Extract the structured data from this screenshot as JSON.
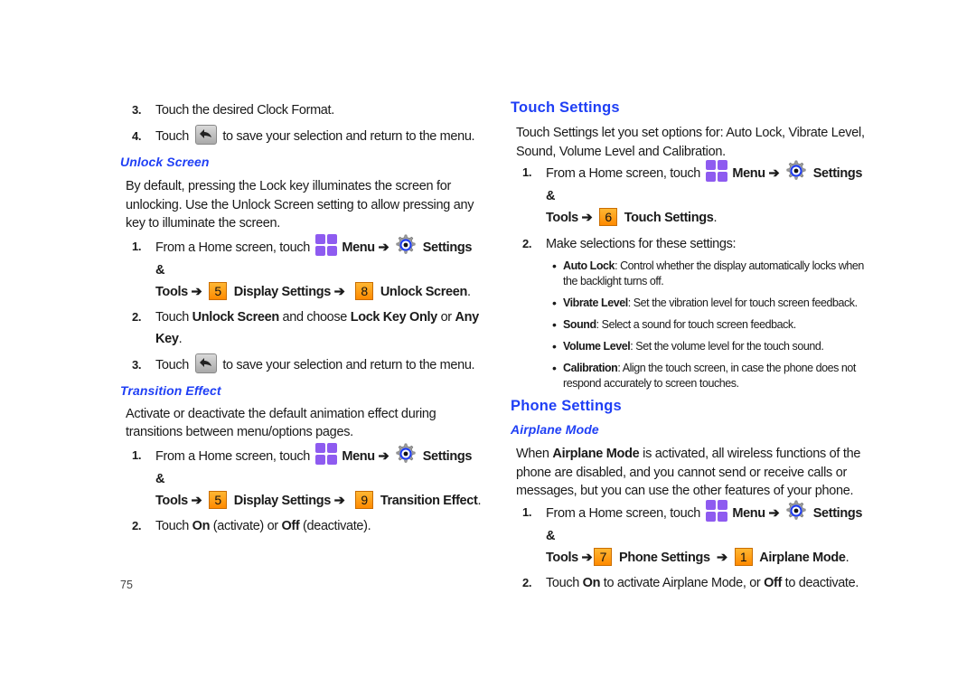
{
  "page_number": "75",
  "left": {
    "intro_steps": [
      {
        "num": "3.",
        "text": "Touch the desired Clock Format."
      },
      {
        "num": "4.",
        "pre": "Touch",
        "post": "to save your selection and return to the menu."
      }
    ],
    "unlock_screen": {
      "heading": "Unlock Screen",
      "paragraph": "By default, pressing the Lock key illuminates the screen for unlocking. Use the Unlock Screen setting to allow pressing any key to illuminate the screen.",
      "step1": {
        "num": "1.",
        "pre": "From a Home screen, touch",
        "menu": "Menu",
        "arrow": "➔",
        "settings": "Settings &",
        "tools": "Tools",
        "key1": "5",
        "item1": "Display Settings",
        "key2": "8",
        "item2": "Unlock Screen",
        "end": "."
      },
      "step2": {
        "num": "2.",
        "pre": "Touch",
        "b1": "Unlock Screen",
        "mid": "and choose",
        "b2": "Lock Key Only",
        "or": "or",
        "b3": "Any Key",
        "end": "."
      },
      "step3": {
        "num": "3.",
        "pre": "Touch",
        "post": "to save your selection and return to the menu."
      }
    },
    "transition_effect": {
      "heading": "Transition Effect",
      "paragraph": "Activate or deactivate the default animation effect during transitions between menu/options pages.",
      "step1": {
        "num": "1.",
        "pre": "From a Home screen, touch",
        "menu": "Menu",
        "arrow": "➔",
        "settings": "Settings &",
        "tools": "Tools",
        "key1": "5",
        "item1": "Display Settings",
        "key2": "9",
        "item2": "Transition Effect",
        "end": "."
      },
      "step2": {
        "num": "2.",
        "pre": "Touch",
        "b1": "On",
        "mid": "(activate) or",
        "b2": "Off",
        "post": "(deactivate)."
      }
    }
  },
  "right": {
    "touch_settings": {
      "heading": "Touch Settings",
      "paragraph": "Touch Settings let you set options for: Auto Lock, Vibrate Level, Sound, Volume Level and Calibration.",
      "step1": {
        "num": "1.",
        "pre": "From a Home screen, touch",
        "menu": "Menu",
        "arrow": "➔",
        "settings": "Settings &",
        "tools": "Tools",
        "key1": "6",
        "item1": "Touch Settings",
        "end": "."
      },
      "step2": {
        "num": "2.",
        "text": "Make selections for these settings:"
      },
      "bullets": [
        {
          "term": "Auto Lock",
          "desc": ": Control whether the display automatically locks when the backlight turns off."
        },
        {
          "term": "Vibrate Level",
          "desc": ": Set the vibration level for touch screen feedback."
        },
        {
          "term": "Sound",
          "desc": ": Select a sound for touch screen feedback."
        },
        {
          "term": "Volume Level",
          "desc": ": Set the volume level for the touch sound."
        },
        {
          "term": "Calibration",
          "desc": ": Align the touch screen, in case the phone does not respond accurately to screen touches."
        }
      ]
    },
    "phone_settings": {
      "heading": "Phone Settings",
      "airplane_mode": {
        "heading": "Airplane Mode",
        "para_pre": "When",
        "para_bold": "Airplane Mode",
        "para_post": "is activated, all wireless functions of the phone are disabled, and you cannot send or receive calls or messages, but you can use the other features of your phone.",
        "step1": {
          "num": "1.",
          "pre": "From a Home screen, touch",
          "menu": "Menu",
          "arrow": "➔",
          "settings": "Settings &",
          "tools": "Tools",
          "key1": "7",
          "item1": "Phone Settings",
          "key2": "1",
          "item2": "Airplane Mode",
          "end": "."
        },
        "step2": {
          "num": "2.",
          "pre": "Touch",
          "b1": "On",
          "mid": "to activate Airplane Mode, or",
          "b2": "Off",
          "post": "to deactivate."
        }
      }
    }
  },
  "colors": {
    "heading_blue": "#1f3ff5",
    "key_orange": "#ff9a10",
    "menu_purple": "#8e5bf0",
    "gear_blue": "#1e3cf0"
  }
}
